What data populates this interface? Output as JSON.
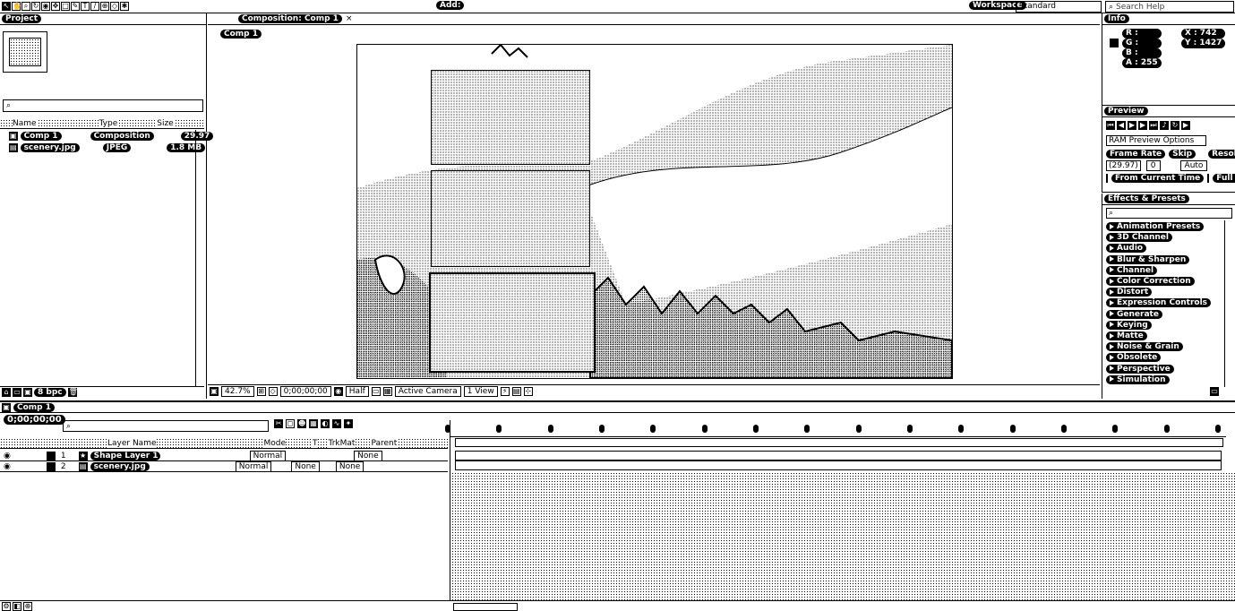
{
  "menubar": {
    "left_icons": [
      "arrow-tool-icon",
      "hand-tool-icon",
      "zoom-tool-icon",
      "rotate-tool-icon",
      "camera-tool-icon",
      "pan-behind-icon",
      "mask-tool-icon",
      "pen-tool-icon",
      "text-tool-icon",
      "brush-tool-icon",
      "clone-tool-icon",
      "eraser-tool-icon",
      "puppet-tool-icon"
    ],
    "add_label": "Add:",
    "workspace_label": "Workspace",
    "workspace_value": "Standard",
    "search_placeholder": "Search Help"
  },
  "project": {
    "tab": "Project",
    "columns": [
      "Name",
      "Type",
      "Size"
    ],
    "items": [
      {
        "name": "Comp 1",
        "type": "Composition",
        "size": "",
        "extra": "29.97"
      },
      {
        "name": "scenery.jpg",
        "type": "JPEG",
        "size": "1.8 MB"
      }
    ],
    "bpc": "8 bpc"
  },
  "composition": {
    "tab": "Composition: Comp 1",
    "sub_tab": "Comp 1",
    "zoom": "42.7%",
    "timecode": "0;00;00;00",
    "resolution": "Half",
    "camera": "Active Camera",
    "views": "1 View"
  },
  "info": {
    "tab": "Info",
    "r": "R :",
    "g": "G :",
    "b": "B :",
    "a": "A : 255",
    "x": "X : 742",
    "y": "Y : 1427"
  },
  "preview": {
    "tab": "Preview",
    "ram_options": "RAM Preview Options",
    "frame_rate_label": "Frame Rate",
    "skip_label": "Skip",
    "resolution_label": "Resolution",
    "frame_rate_value": "(29.97)",
    "skip_value": "0",
    "resolution_value": "Auto",
    "from_current": "From Current Time",
    "full_screen": "Full Screen"
  },
  "effects": {
    "tab": "Effects & Presets",
    "items": [
      "Animation Presets",
      "3D Channel",
      "Audio",
      "Blur & Sharpen",
      "Channel",
      "Color Correction",
      "Distort",
      "Expression Controls",
      "Generate",
      "Keying",
      "Matte",
      "Noise & Grain",
      "Obsolete",
      "Perspective",
      "Simulation"
    ]
  },
  "timeline": {
    "tab": "Comp 1",
    "timecode": "0;00;00;00",
    "columns": [
      "Layer Name",
      "Mode",
      "T",
      "TrkMat",
      "Parent"
    ],
    "layers": [
      {
        "num": "1",
        "name": "Shape Layer 1",
        "mode": "Normal",
        "trkmat": "",
        "parent": "None"
      },
      {
        "num": "2",
        "name": "scenery.jpg",
        "mode": "Normal",
        "trkmat": "None",
        "parent": "None"
      }
    ],
    "ruler_marks": 16
  }
}
